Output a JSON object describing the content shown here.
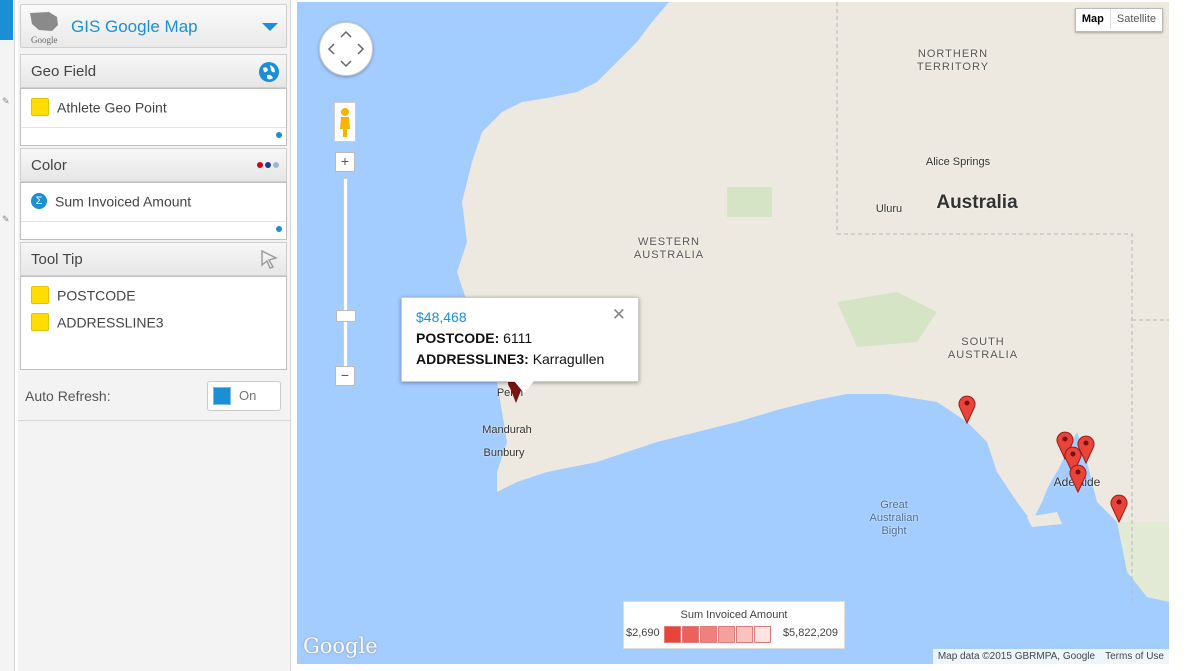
{
  "panel": {
    "title": "GIS Google Map",
    "logo_text": "Google",
    "sections": {
      "geo": {
        "label": "Geo Field",
        "items": [
          "Athlete Geo Point"
        ]
      },
      "color": {
        "label": "Color",
        "items": [
          "Sum Invoiced Amount"
        ]
      },
      "tooltip": {
        "label": "Tool Tip",
        "items": [
          "POSTCODE",
          "ADDRESSLINE3"
        ]
      }
    },
    "auto_refresh": {
      "label": "Auto Refresh:",
      "state": "On"
    }
  },
  "map": {
    "type_buttons": {
      "map": "Map",
      "satellite": "Satellite"
    },
    "labels": {
      "northern_territory": "NORTHERN\nTERRITORY",
      "western_australia": "WESTERN\nAUSTRALIA",
      "south_australia": "SOUTH\nAUSTRALIA",
      "australia": "Australia",
      "alice_springs": "Alice Springs",
      "uluru": "Uluru",
      "perth": "Perth",
      "mandurah": "Mandurah",
      "bunbury": "Bunbury",
      "adelaide": "Adelaide",
      "bight": "Great\nAustralian\nBight"
    },
    "popup": {
      "value": "$48,468",
      "postcode_key": "POSTCODE:",
      "postcode_val": "6111",
      "address_key": "ADDRESSLINE3:",
      "address_val": "Karragullen"
    },
    "legend": {
      "title": "Sum Invoiced Amount",
      "min": "$2,690",
      "max": "$5,822,209",
      "swatches": [
        "#e8443a",
        "#ec6159",
        "#f0817a",
        "#f4a19c",
        "#f8c3bf",
        "#fce5e3"
      ]
    },
    "attribution": {
      "data": "Map data ©2015 GBRMPA, Google",
      "terms": "Terms of Use"
    },
    "google_logo": "Google",
    "marker_color": "#e8443a"
  }
}
